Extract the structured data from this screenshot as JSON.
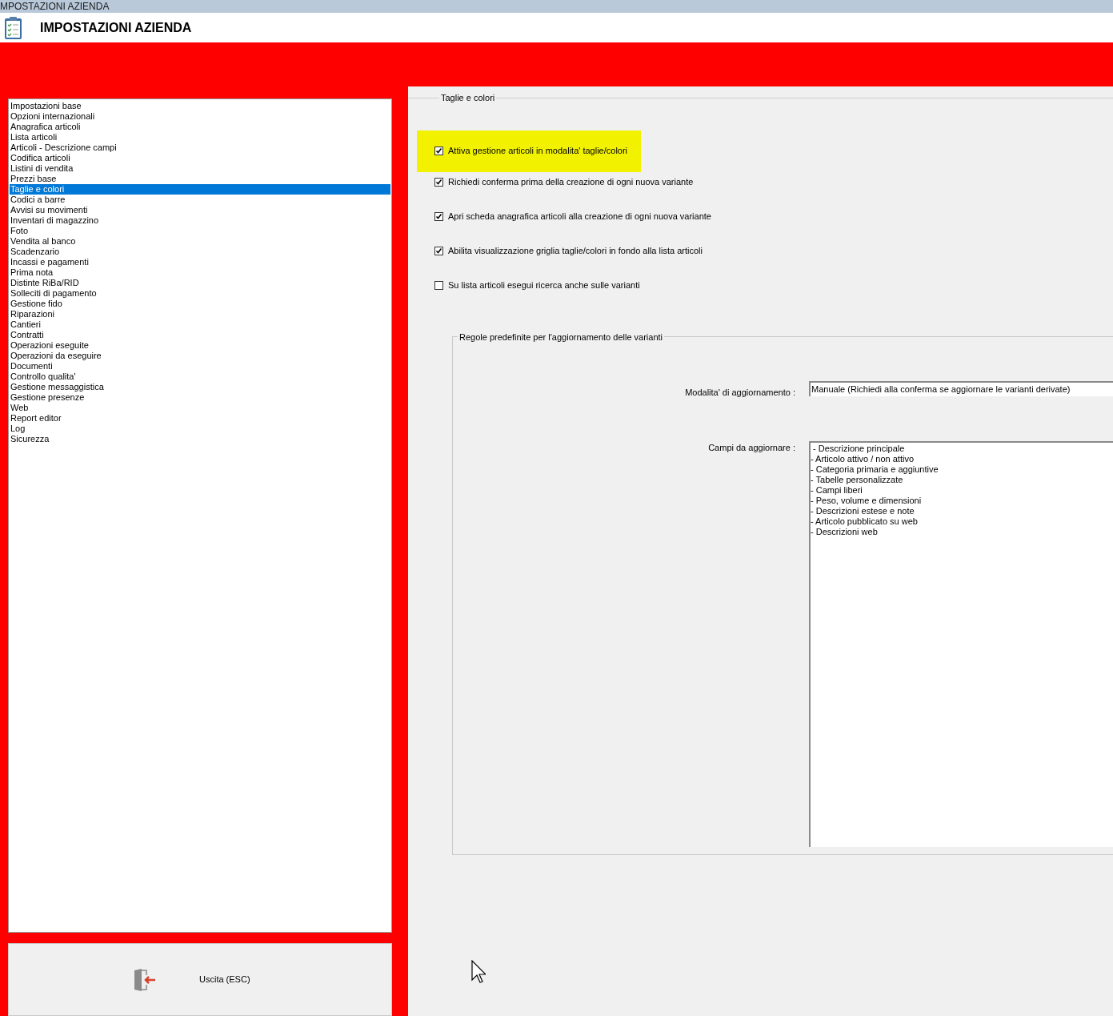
{
  "window": {
    "title": "MPOSTAZIONI AZIENDA"
  },
  "header": {
    "title": "IMPOSTAZIONI AZIENDA"
  },
  "sidebar": {
    "items": [
      {
        "label": "Impostazioni base",
        "selected": false
      },
      {
        "label": "Opzioni internazionali",
        "selected": false
      },
      {
        "label": "Anagrafica articoli",
        "selected": false
      },
      {
        "label": "Lista articoli",
        "selected": false
      },
      {
        "label": "Articoli - Descrizione campi",
        "selected": false
      },
      {
        "label": "Codifica articoli",
        "selected": false
      },
      {
        "label": "Listini di vendita",
        "selected": false
      },
      {
        "label": "Prezzi base",
        "selected": false
      },
      {
        "label": "Taglie e colori",
        "selected": true
      },
      {
        "label": "Codici a barre",
        "selected": false
      },
      {
        "label": "Avvisi su movimenti",
        "selected": false
      },
      {
        "label": "Inventari di magazzino",
        "selected": false
      },
      {
        "label": "Foto",
        "selected": false
      },
      {
        "label": "Vendita al banco",
        "selected": false
      },
      {
        "label": "Scadenzario",
        "selected": false
      },
      {
        "label": "Incassi e pagamenti",
        "selected": false
      },
      {
        "label": "Prima nota",
        "selected": false
      },
      {
        "label": "Distinte RiBa/RID",
        "selected": false
      },
      {
        "label": "Solleciti di pagamento",
        "selected": false
      },
      {
        "label": "Gestione fido",
        "selected": false
      },
      {
        "label": "Riparazioni",
        "selected": false
      },
      {
        "label": "Cantieri",
        "selected": false
      },
      {
        "label": "Contratti",
        "selected": false
      },
      {
        "label": "Operazioni eseguite",
        "selected": false
      },
      {
        "label": "Operazioni da eseguire",
        "selected": false
      },
      {
        "label": "Documenti",
        "selected": false
      },
      {
        "label": "Controllo qualita'",
        "selected": false
      },
      {
        "label": "Gestione messaggistica",
        "selected": false
      },
      {
        "label": "Gestione presenze",
        "selected": false
      },
      {
        "label": "Web",
        "selected": false
      },
      {
        "label": "Report editor",
        "selected": false
      },
      {
        "label": "Log",
        "selected": false
      },
      {
        "label": "Sicurezza",
        "selected": false
      }
    ]
  },
  "exit_button": {
    "label": "Uscita (ESC)"
  },
  "panel": {
    "title": "Taglie e colori",
    "options": [
      {
        "label": "Attiva gestione articoli in modalita' taglie/colori",
        "checked": true,
        "highlighted": true
      },
      {
        "label": "Richiedi conferma prima della creazione di ogni nuova variante",
        "checked": true,
        "highlighted": false
      },
      {
        "label": "Apri scheda anagrafica articoli alla creazione di ogni nuova variante",
        "checked": true,
        "highlighted": false
      },
      {
        "label": "Abilita visualizzazione griglia taglie/colori in fondo alla lista articoli",
        "checked": true,
        "highlighted": false
      },
      {
        "label": "Su lista articoli esegui ricerca anche sulle varianti",
        "checked": false,
        "highlighted": false
      }
    ],
    "rules": {
      "title": "Regole predefinite per l'aggiornamento delle varianti",
      "mode_label": "Modalita' di aggiornamento :",
      "mode_value": "Manuale (Richiedi alla conferma se aggiornare le varianti derivate)",
      "fields_label": "Campi da aggiornare :",
      "fields": [
        " - Descrizione principale",
        "- Articolo attivo / non attivo",
        "- Categoria primaria e aggiuntive",
        "- Tabelle personalizzate",
        "- Campi liberi",
        "- Peso, volume e dimensioni",
        "- Descrizioni estese e note",
        "- Articolo pubblicato su web",
        "- Descrizioni web"
      ]
    }
  }
}
